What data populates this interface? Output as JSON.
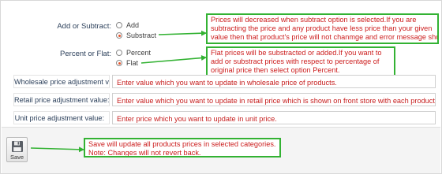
{
  "add_or_subtract": {
    "label": "Add or Subtract:",
    "options": [
      {
        "label": "Add",
        "selected": false
      },
      {
        "label": "Substract",
        "selected": true
      }
    ],
    "note": [
      "Prices will decreased when subtract option is selected.If you are",
      "subtracting the price and any product have less price than your given",
      "value then that product's price will not chanmge and error message shown"
    ]
  },
  "percent_or_flat": {
    "label": "Percent or Flat:",
    "options": [
      {
        "label": "Percent",
        "selected": false
      },
      {
        "label": "Flat",
        "selected": true
      }
    ],
    "note": [
      "Flat prices will be substracted or added.If you want to",
      "add or substract prices with respect to percentage of",
      "original price then select option Percent."
    ]
  },
  "fields": [
    {
      "label": "Wholesale price adjustment value:",
      "value": "Enter value which you want to update in wholesale price of products."
    },
    {
      "label": "Retail price adjustment value:",
      "value": "Enter value which you want to update in retail price which is shown on front store with each product."
    },
    {
      "label": "Unit price adjustment value:",
      "value": "Enter price which you want to update in unit price."
    }
  ],
  "save": {
    "label": "Save",
    "note": [
      "Save will update all products prices in selected categories.",
      "Note: Changes will not revert back."
    ]
  },
  "colors": {
    "note_border": "#33b233",
    "note_text": "#cc1d1d",
    "radio_selected": "#e6532a",
    "label_text": "#2b3f5a"
  }
}
